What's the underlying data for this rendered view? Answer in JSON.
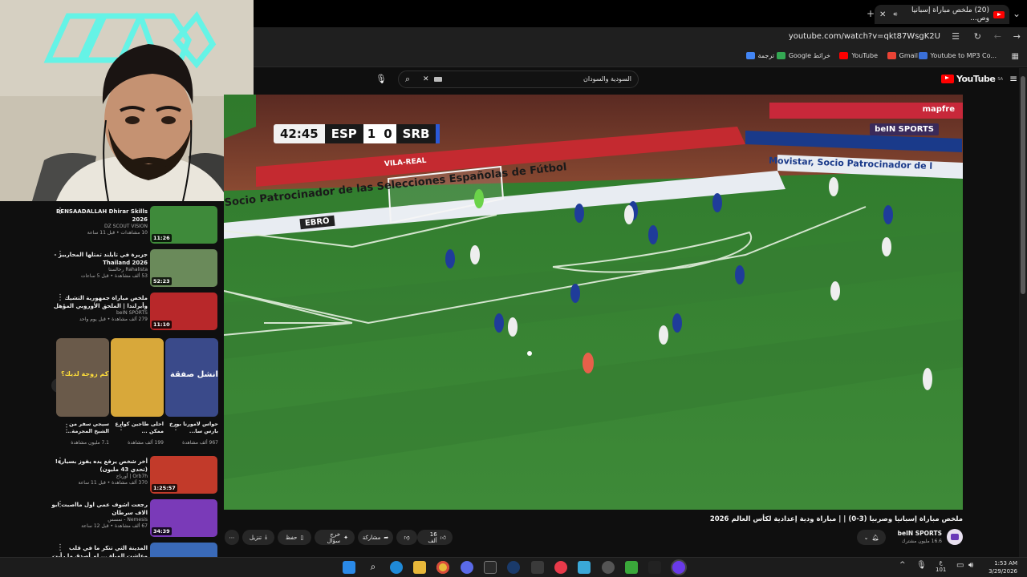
{
  "browser": {
    "tab_title": "(20) ملخص مباراة إسبانيا وص...",
    "new_tab_icon": "plus-icon",
    "url": "youtube.com/watch?v=qkt87WsgK2U",
    "bookmarks": [
      {
        "label": "Youtube to MP3 Co...",
        "color": "#3a6fd8"
      },
      {
        "label": "Gmail",
        "color": "#ea4335"
      },
      {
        "label": "YouTube",
        "color": "#ff0000"
      },
      {
        "label": "Google خرائط",
        "color": "#34a853"
      },
      {
        "label": "ترجمة",
        "color": "#4285f4"
      }
    ]
  },
  "youtube": {
    "logo": "YouTube",
    "region": "SA",
    "search_query": "السودية والسودان"
  },
  "scoreboard": {
    "time": "42:45",
    "home": "ESP",
    "home_score": "1",
    "away_score": "0",
    "away": "SRB",
    "broadcaster": "beIN SPORTS"
  },
  "stadium_text": {
    "board1": "Socio Patrocinador de las Selecciones Españolas de Fútbol",
    "board2": "Movistar, Socio Patrocinador de l",
    "board3": "EBRO",
    "board4": "mapfre",
    "board5": "VILA-REAL"
  },
  "video": {
    "title": "ملخص مباراة إسبانيا وصربيا (3-0) | | مباراة ودية إعدادية لكأس العالم 2026",
    "channel": "beIN SPORTS",
    "subscribers": "16.6 مليون مشترك",
    "likes": "16 ألف",
    "share": "مشاركة",
    "remix": "خرج سؤال",
    "save": "حفظ",
    "download": "تنزيل"
  },
  "recommendations": [
    {
      "title": "BENSAADALLAH Dhirar Skills 2026",
      "channel": "DZ SCOUT VISION",
      "meta": "10 مشاهدات • قبل 11 ساعة",
      "duration": "11:26",
      "color": "#3e8a3a"
    },
    {
      "title": "جزيرة في تايلند تمتلها المحاربير - Thailand 2026",
      "channel": "Rahalista رحالستا",
      "meta": "53 ألف مشاهدة • قبل 5 ساعات",
      "duration": "52:23",
      "color": "#6a8a5a"
    },
    {
      "title": "ملخص مباراة جمهورية التشيك وأيرلندا | الملحق الأوروبي المؤهل لكأس العالم FIFA...",
      "channel": "beIN SPORTS",
      "meta": "279 ألف مشاهدة • قبل يوم واحد",
      "duration": "11:10",
      "color": "#b8282a"
    },
    {
      "title": "أخر شخص يرفع يده يفوز بسيارة! (تحدي 43 مليون)",
      "channel": "Orb7h | أورباح",
      "meta": "370 ألف مشاهدة • قبل 11 ساعة",
      "duration": "1:25:57",
      "color": "#c23a2a"
    },
    {
      "title": "رجعت اشوف عمي اول مااصبت ابو الاف سرطان",
      "channel": "Nemesis - نمسس",
      "meta": "67 ألف مشاهدة • قبل 12 ساعة",
      "duration": "34:39",
      "color": "#7a3ab8"
    },
    {
      "title": "المدينة التي تنكر ما في قلب وعاشت المياة ... لم أصدق ما رأيت في العراق",
      "channel": "",
      "meta": "",
      "duration": "",
      "color": "#3a6ab8"
    }
  ],
  "shorts": [
    {
      "title": "حواس لامورنا بورخ بارس سا...",
      "views": "967 ألف مشاهدة",
      "color": "#3a4a8a"
    },
    {
      "title": "احلى طاجين كوارع ممكن ...",
      "views": "199 ألف مشاهدة",
      "color": "#d8a83a"
    },
    {
      "title": "سيجي سفر من الشيخ المجرمة...",
      "views": "7.1 مليون مشاهدة",
      "color": "#6a5a4a"
    }
  ],
  "shorts_labels": {
    "s1": "انشل صفقة",
    "s2": "",
    "s3": "كم زوجة لديك؟"
  },
  "taskbar": {
    "time": "1:53 AM",
    "date": "3/29/2026",
    "lang": "ع",
    "lang_sub": "101"
  }
}
